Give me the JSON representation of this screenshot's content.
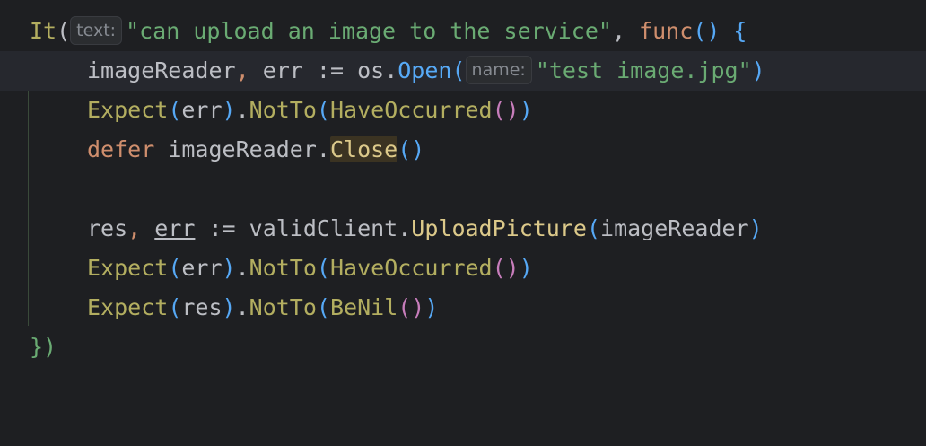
{
  "editor": {
    "lines": [
      {
        "it_fn": "It",
        "hint_text": "text:",
        "test_name": "\"can upload an image to the service\"",
        "func_kw": "func",
        "tail": "() {"
      },
      {
        "var": "imageReader",
        "err": "err",
        "op": ":=",
        "pkg": "os",
        "fn": "Open",
        "hint_name": "name:",
        "arg": "\"test_image.jpg\""
      },
      {
        "expect": "Expect",
        "arg": "err",
        "notto": "NotTo",
        "matcher": "HaveOccurred"
      },
      {
        "defer_kw": "defer",
        "obj": "imageReader",
        "method": "Close"
      },
      {
        "var1": "res",
        "var2": "err",
        "op": ":=",
        "client": "validClient",
        "method": "UploadPicture",
        "arg": "imageReader"
      },
      {
        "expect": "Expect",
        "arg": "err",
        "notto": "NotTo",
        "matcher": "HaveOccurred"
      },
      {
        "expect": "Expect",
        "arg": "res",
        "notto": "NotTo",
        "matcher": "BeNil"
      },
      {
        "closing": "})"
      }
    ]
  }
}
